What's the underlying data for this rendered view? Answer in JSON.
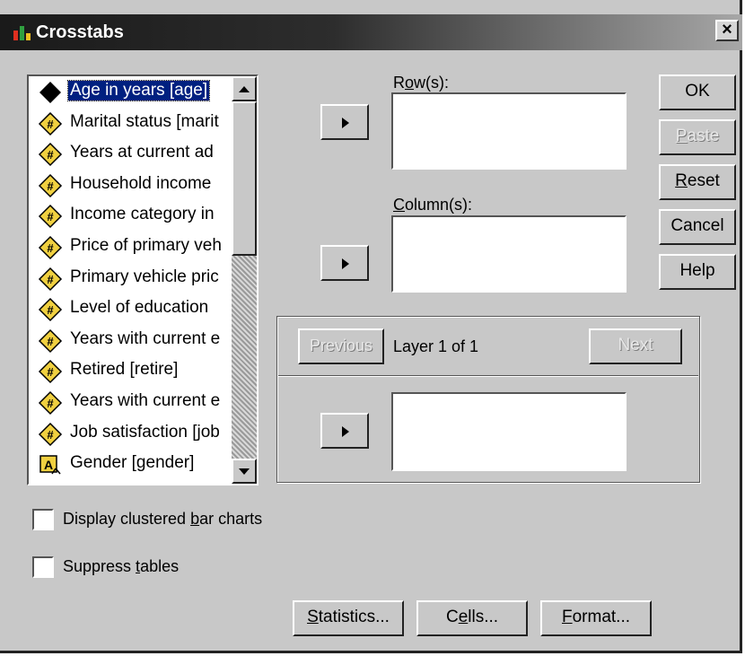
{
  "window": {
    "title": "Crosstabs",
    "close_glyph": "×"
  },
  "variables": [
    {
      "label": "Age in years [age]",
      "icon": "scale-icon",
      "selected": true
    },
    {
      "label": "Marital status [marit",
      "icon": "numeric-icon",
      "selected": false
    },
    {
      "label": "Years at current ad",
      "icon": "numeric-icon",
      "selected": false
    },
    {
      "label": "Household income",
      "icon": "numeric-icon",
      "selected": false
    },
    {
      "label": "Income category in",
      "icon": "numeric-icon",
      "selected": false
    },
    {
      "label": "Price of primary veh",
      "icon": "numeric-icon",
      "selected": false
    },
    {
      "label": "Primary vehicle pric",
      "icon": "numeric-icon",
      "selected": false
    },
    {
      "label": "Level of education",
      "icon": "numeric-icon",
      "selected": false
    },
    {
      "label": "Years with current e",
      "icon": "numeric-icon",
      "selected": false
    },
    {
      "label": "Retired [retire]",
      "icon": "numeric-icon",
      "selected": false
    },
    {
      "label": "Years with current e",
      "icon": "numeric-icon",
      "selected": false
    },
    {
      "label": "Job satisfaction [job",
      "icon": "numeric-icon",
      "selected": false
    },
    {
      "label": "Gender [gender]",
      "icon": "string-icon",
      "selected": false
    }
  ],
  "rows": {
    "label_pre": "R",
    "label_ul": "o",
    "label_post": "w(s):"
  },
  "columns": {
    "label_pre": "",
    "label_ul": "C",
    "label_post": "olumn(s):"
  },
  "layer": {
    "previous_label": "Previous",
    "text": "Layer 1 of 1",
    "next_label": "Next"
  },
  "buttons": {
    "ok": "OK",
    "paste_ul": "P",
    "paste_rest": "aste",
    "reset_ul": "R",
    "reset_rest": "eset",
    "cancel": "Cancel",
    "help": "Help",
    "statistics_ul": "S",
    "statistics_rest": "tatistics...",
    "cells_pre": "C",
    "cells_ul": "e",
    "cells_rest": "lls...",
    "format_ul": "F",
    "format_rest": "ormat..."
  },
  "options": {
    "clustered_pre": "Display clustered ",
    "clustered_ul": "b",
    "clustered_post": "ar charts",
    "clustered_checked": false,
    "suppress_pre": "Suppress ",
    "suppress_ul": "t",
    "suppress_post": "ables",
    "suppress_checked": false
  },
  "colors": {
    "selection": "#002080",
    "dialog_face": "#c8c8c8",
    "icon_yellow": "#f0d040"
  }
}
